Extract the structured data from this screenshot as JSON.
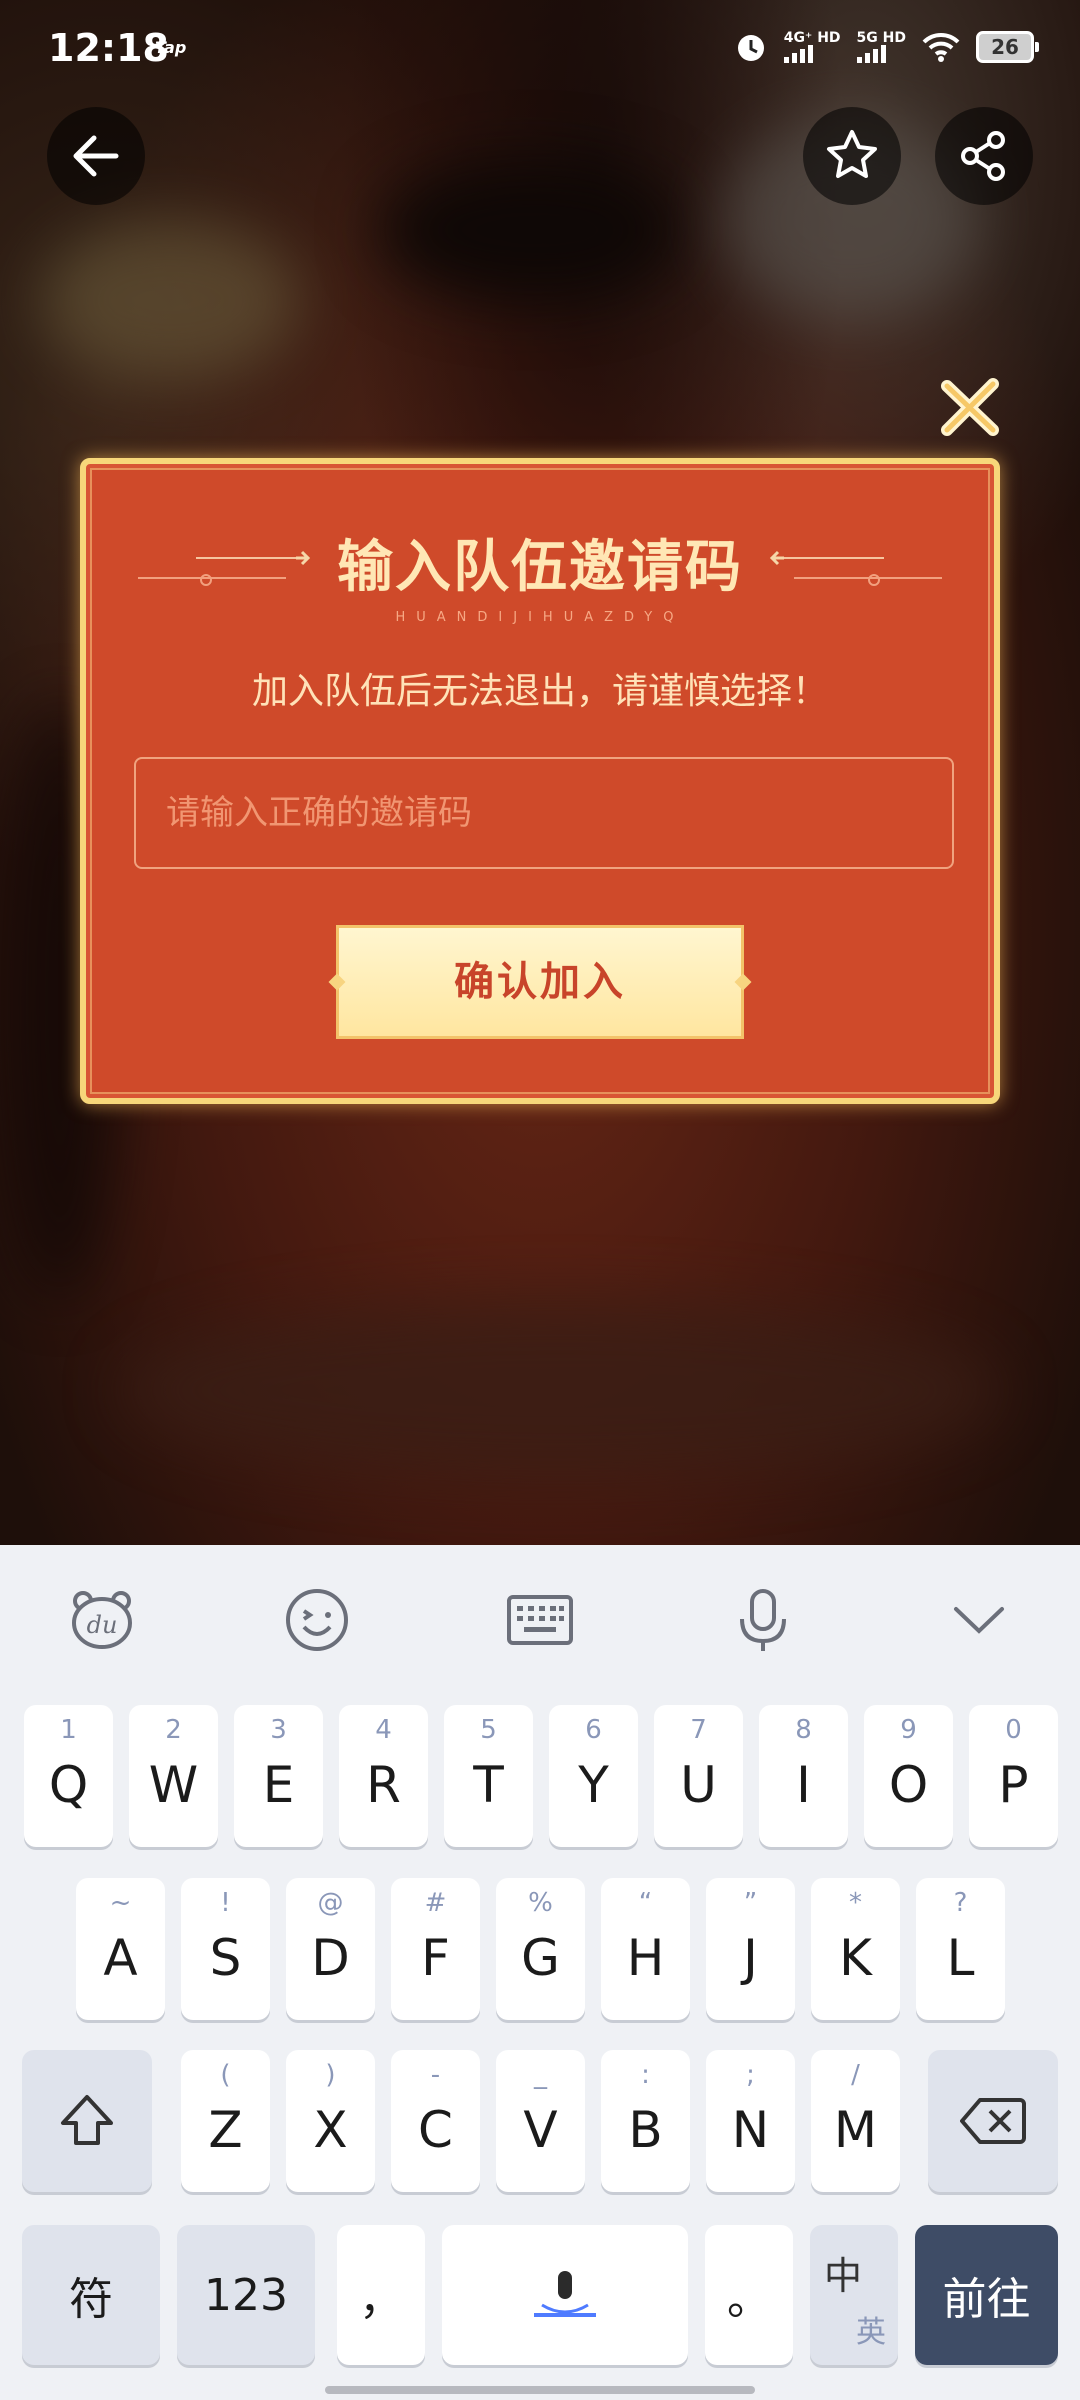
{
  "status_bar": {
    "time": "12:18",
    "app_tag": "Tap",
    "net1": "4G⁺ HD",
    "net2": "5G HD",
    "battery": "26"
  },
  "dialog": {
    "title": "输入队伍邀请码",
    "pinyin": "HUANDIJIHUAZDYQ",
    "warning": "加入队伍后无法退出，请谨慎选择！",
    "input_placeholder": "请输入正确的邀请码",
    "confirm_label": "确认加入"
  },
  "keyboard": {
    "row1": [
      {
        "sub": "1",
        "main": "Q"
      },
      {
        "sub": "2",
        "main": "W"
      },
      {
        "sub": "3",
        "main": "E"
      },
      {
        "sub": "4",
        "main": "R"
      },
      {
        "sub": "5",
        "main": "T"
      },
      {
        "sub": "6",
        "main": "Y"
      },
      {
        "sub": "7",
        "main": "U"
      },
      {
        "sub": "8",
        "main": "I"
      },
      {
        "sub": "9",
        "main": "O"
      },
      {
        "sub": "0",
        "main": "P"
      }
    ],
    "row2": [
      {
        "sub": "~",
        "main": "A"
      },
      {
        "sub": "!",
        "main": "S"
      },
      {
        "sub": "@",
        "main": "D"
      },
      {
        "sub": "#",
        "main": "F"
      },
      {
        "sub": "%",
        "main": "G"
      },
      {
        "sub": "“",
        "main": "H"
      },
      {
        "sub": "”",
        "main": "J"
      },
      {
        "sub": "*",
        "main": "K"
      },
      {
        "sub": "?",
        "main": "L"
      }
    ],
    "row3": [
      {
        "sub": "(",
        "main": "Z"
      },
      {
        "sub": ")",
        "main": "X"
      },
      {
        "sub": "-",
        "main": "C"
      },
      {
        "sub": "_",
        "main": "V"
      },
      {
        "sub": ":",
        "main": "B"
      },
      {
        "sub": ";",
        "main": "N"
      },
      {
        "sub": "/",
        "main": "M"
      }
    ],
    "symbols": "符",
    "numbers": "123",
    "comma": "，",
    "period": "。",
    "lang_zh": "中",
    "lang_en": "英",
    "go": "前往"
  },
  "colors": {
    "dialog_red": "#cf4a2a",
    "gold": "#f7d77a",
    "go_key": "#3e4c66"
  },
  "icons": [
    "back-arrow-icon",
    "star-icon",
    "share-icon",
    "close-x-icon",
    "du-bear-icon",
    "emoji-icon",
    "keyboard-icon",
    "microphone-icon",
    "chevron-down-icon",
    "shift-icon",
    "backspace-icon",
    "voice-space-icon"
  ]
}
